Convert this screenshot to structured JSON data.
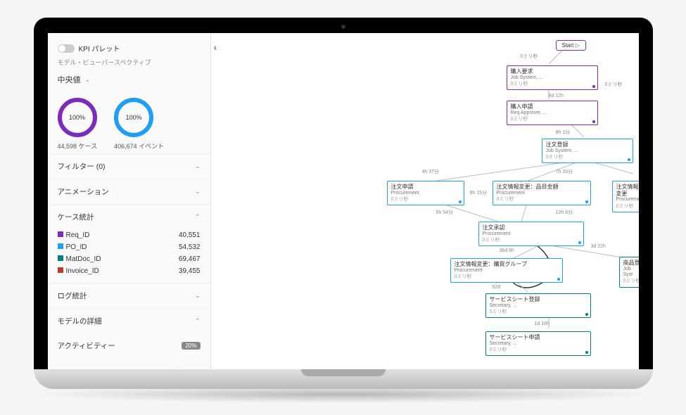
{
  "sidebar": {
    "palette_label": "KPI パレット",
    "perspective_label": "モデル・ビューパースペクティブ",
    "dropdown_value": "中央値",
    "ring1_pct": "100%",
    "ring1_label": "44,598 ケース",
    "ring2_pct": "100%",
    "ring2_label": "406,674 イベント",
    "acc_filter": "フィルター (0)",
    "acc_animation": "アニメーション",
    "acc_case_stats": "ケース統計",
    "stats": [
      {
        "label": "Req_ID",
        "value": "40,551",
        "color": "sw-purple"
      },
      {
        "label": "PO_ID",
        "value": "54,532",
        "color": "sw-blue"
      },
      {
        "label": "MatDoc_ID",
        "value": "69,467",
        "color": "sw-teal"
      },
      {
        "label": "Invoice_ID",
        "value": "39,455",
        "color": "sw-red"
      }
    ],
    "acc_log_stats": "ログ統計",
    "acc_model_detail": "モデルの詳細",
    "acc_activity": "アクティビティー",
    "activity_badge": "20%"
  },
  "canvas": {
    "start": "Start",
    "nodes": {
      "n1": {
        "title": "購入要求",
        "sub": "Job System, ...",
        "time": "0ミリ秒"
      },
      "n2": {
        "title": "購入申請",
        "sub": "Req Approver, ...",
        "time": "0ミリ秒"
      },
      "n3": {
        "title": "注文登録",
        "sub": "Job System, ...",
        "time": "0ミリ秒"
      },
      "n4": {
        "title": "注文申請",
        "sub": "Procurement",
        "time": "0ミリ秒"
      },
      "n5": {
        "title": "注文情報変更：品目金額",
        "sub": "Procurement",
        "time": "0ミリ秒"
      },
      "n6": {
        "title": "注文情報変更",
        "sub": "Procurement",
        "time": "0ミリ秒"
      },
      "n7": {
        "title": "注文承認",
        "sub": "Procurement",
        "time": "0ミリ秒"
      },
      "n8": {
        "title": "注文情報変更：購買グループ",
        "sub": "Procurement",
        "time": "0ミリ秒"
      },
      "n9": {
        "title": "商品登",
        "sub": "Job Syst",
        "time": "0ミリ秒"
      },
      "n10": {
        "title": "サービスシート登録",
        "sub": "Secretary, ...",
        "time": "0ミリ秒"
      },
      "n11": {
        "title": "サービスシート申請",
        "sub": "Secretary, ...",
        "time": "0ミリ秒"
      }
    },
    "edges": {
      "e1": "0ミリ秒",
      "e2": "0ミリ秒",
      "e3": "8d 12h",
      "e4": "8h 1分",
      "e5": "4h 37分",
      "e6": "7h 33分",
      "e7": "8h 15分",
      "e8": "5h 54分",
      "e9": "12h 8分",
      "e10": "36d 6h",
      "e11": "92d",
      "e12": "3d 22h",
      "e13": "1d 16h"
    }
  }
}
